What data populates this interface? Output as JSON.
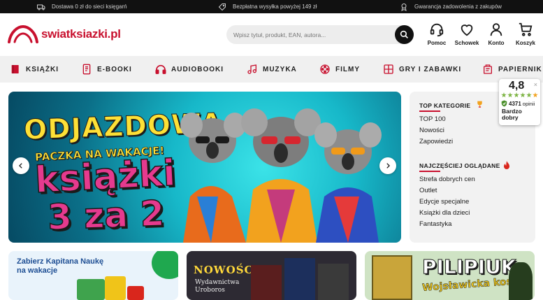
{
  "topbar": {
    "items": [
      {
        "icon": "truck-icon",
        "text": "Dostawa 0 zł do sieci księgarń"
      },
      {
        "icon": "tag-icon",
        "text": "Bezpłatna wysyłka powyżej 149 zł"
      },
      {
        "icon": "badge-icon",
        "text": "Gwarancja zadowolenia z zakupów"
      }
    ]
  },
  "header": {
    "logo_text": "swiatksiazki.pl",
    "search_placeholder": "Wpisz tytuł, produkt, EAN, autora...",
    "icons": [
      {
        "icon": "headset-icon",
        "label": "Pomoc"
      },
      {
        "icon": "heart-icon",
        "label": "Schowek"
      },
      {
        "icon": "user-icon",
        "label": "Konto"
      },
      {
        "icon": "cart-icon",
        "label": "Koszyk"
      }
    ]
  },
  "nav": {
    "items": [
      {
        "icon": "book-icon",
        "label": "KSIĄŻKI"
      },
      {
        "icon": "ebook-icon",
        "label": "E-BOOKI"
      },
      {
        "icon": "headphones-icon",
        "label": "AUDIOBOOKI"
      },
      {
        "icon": "music-note-icon",
        "label": "MUZYKA"
      },
      {
        "icon": "film-icon",
        "label": "FILMY"
      },
      {
        "icon": "puzzle-icon",
        "label": "GRY I ZABAWKI"
      },
      {
        "icon": "stationery-icon",
        "label": "PAPIERNIK"
      }
    ]
  },
  "banner": {
    "line1": "ODJAZDOWA",
    "line2": "PACZKA NA WAKACJE!",
    "line3": "książki",
    "line4": "3 za 2"
  },
  "sidebar": {
    "top_heading": "TOP KATEGORIE",
    "top_links": [
      "TOP 100",
      "Nowości",
      "Zapowiedzi"
    ],
    "viewed_heading": "NAJCZĘŚCIEJ OGLĄDANE",
    "viewed_links": [
      "Strefa dobrych cen",
      "Outlet",
      "Edycje specjalne",
      "Książki dla dzieci",
      "Fantastyka"
    ]
  },
  "rating": {
    "score": "4,8",
    "count": "4371",
    "count_label": "opinii",
    "verdict": "Bardzo dobry",
    "close": "×"
  },
  "cards": {
    "card1_text": "Zabierz Kapitana Naukę na wakacje",
    "card2_title": "NOWOŚCI",
    "card2_sub": "Wydawnictwa Uroboros",
    "card3_title": "PILIPIUK",
    "card3_sub": "Wojsławicka kosa"
  },
  "colors": {
    "brand_red": "#c8102e",
    "topbar_bg": "#111111",
    "nav_bg": "#f0f0f0",
    "rating_green": "#7cb342"
  }
}
